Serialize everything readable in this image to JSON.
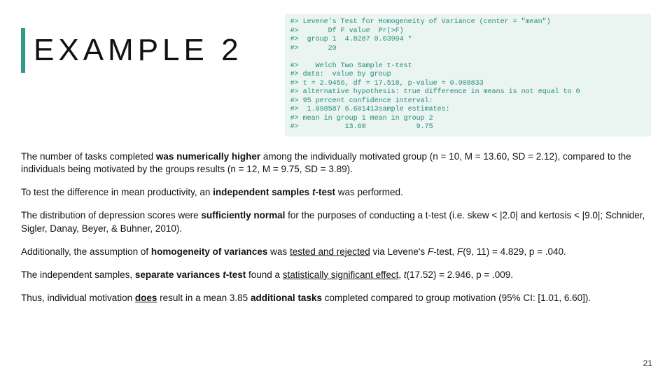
{
  "title": "EXAMPLE 2",
  "code_lines": [
    "#> Levene's Test for Homogeneity of Variance (center = \"mean\")",
    "#>       Df F value  Pr(>F)",
    "#>  group 1  4.8287 0.03994 *",
    "#>       20",
    "",
    "#>    Welch Two Sample t-test",
    "#> data:  value by group",
    "#> t = 2.9456, df = 17.518, p-value = 0.008833",
    "#> alternative hypothesis: true difference in means is not equal to 0",
    "#> 95 percent confidence interval:",
    "#>  1.098587 6.601413sample estimates:",
    "#> mean in group 1 mean in group 2",
    "#>           13.60            9.75"
  ],
  "p1_a": "The number of tasks completed ",
  "p1_b": "was numerically higher",
  "p1_c": " among the individually motivated group (n = 10, M = 13.60, SD = 2.12), compared to the individuals being motivated by the groups results (n = 12, M = 9.75, SD = 3.89).",
  "p2_a": "To test the difference in mean productivity, an ",
  "p2_b": "independent samples ",
  "p2_c": "t",
  "p2_d": "-test",
  "p2_e": " was performed.",
  "p3_a": "The distribution of depression scores were ",
  "p3_b": "sufficiently normal",
  "p3_c": " for the purposes of conducting a t-test (i.e. skew < |2.0| and kertosis < |9.0|; Schnider, Sigler, Danay, Beyer, & Buhner, 2010).",
  "p4_a": "Additionally, the assumption of ",
  "p4_b": "homogeneity of variances",
  "p4_c": " was ",
  "p4_d": "tested and rejected",
  "p4_e": " via Levene's ",
  "p4_f": "F",
  "p4_g": "-test, ",
  "p4_h": "F",
  "p4_i": "(9, 11) = 4.829, p = .040.",
  "p5_a": "The independent samples, ",
  "p5_b": "separate variances ",
  "p5_c": "t",
  "p5_d": "-test",
  "p5_e": " found a ",
  "p5_f": "statistically significant effect",
  "p5_g": ", ",
  "p5_h": "t",
  "p5_i": "(17.52) = 2.946, p = .009.",
  "p6_a": "Thus, individual motivation ",
  "p6_b": "does",
  "p6_c": " result in a mean 3.85 ",
  "p6_d": "additional tasks",
  "p6_e": " completed compared to group motivation (95% CI: [1.01, 6.60]).",
  "page_number": "21"
}
